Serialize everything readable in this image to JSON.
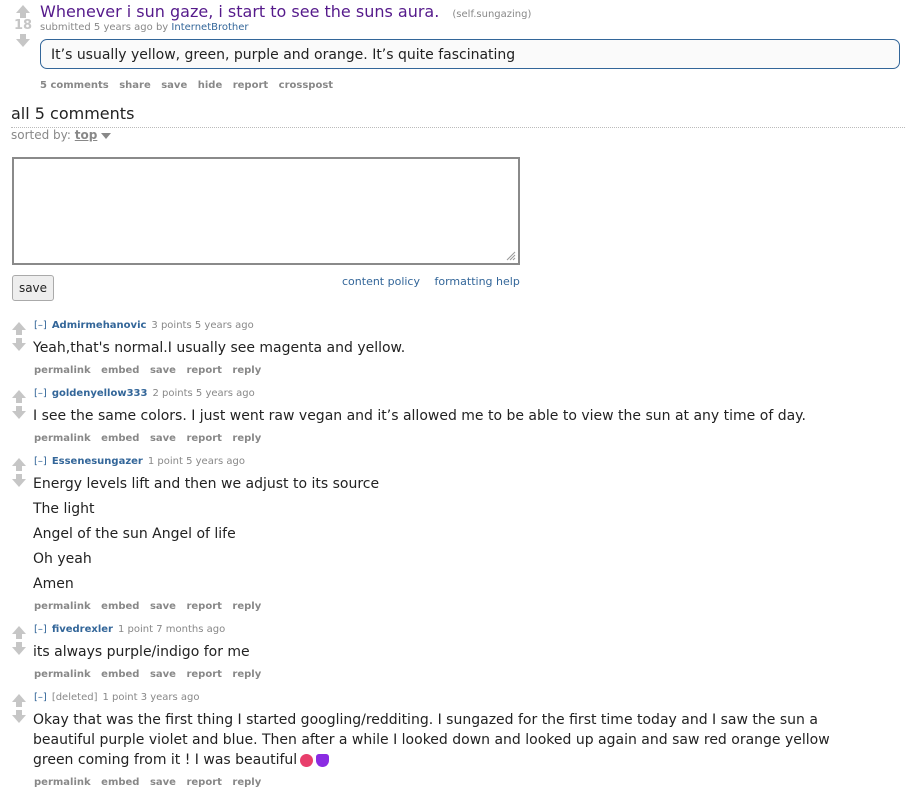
{
  "post": {
    "score": "18",
    "title": "Whenever i sun gaze, i start to see the suns aura.",
    "domain": "(self.sungazing)",
    "submitted_prefix": "submitted 5 years ago by",
    "author": "InternetBrother",
    "selftext": "It’s usually yellow, green, purple and orange. It’s quite fascinating",
    "buttons": [
      "5 comments",
      "share",
      "save",
      "hide",
      "report",
      "crosspost"
    ]
  },
  "comments_header": "all 5 comments",
  "sort": {
    "label": "sorted by:",
    "value": "top"
  },
  "reply_form": {
    "save_label": "save",
    "content_policy": "content policy",
    "formatting_help": "formatting help"
  },
  "comment_buttons": [
    "permalink",
    "embed",
    "save",
    "report",
    "reply"
  ],
  "comments": [
    {
      "expand": "[–]",
      "author": "Admirmehanovic",
      "meta": "3 points 5 years ago",
      "lines": [
        "Yeah,that's normal.I usually see magenta and yellow."
      ]
    },
    {
      "expand": "[–]",
      "author": "goldenyellow333",
      "meta": "2 points 5 years ago",
      "lines": [
        "I see the same colors. I just went raw vegan and it’s allowed me to be able to view the sun at any time of day."
      ]
    },
    {
      "expand": "[–]",
      "author": "Essenesungazer",
      "meta": "1 point 5 years ago",
      "lines": [
        "Energy levels lift and then we adjust to its source",
        "The light",
        "Angel of the sun Angel of life",
        "Oh yeah",
        "Amen"
      ]
    },
    {
      "expand": "[–]",
      "author": "fivedrexler",
      "meta": "1 point 7 months ago",
      "lines": [
        "its always purple/indigo for me"
      ]
    },
    {
      "expand": "[–]",
      "author": "[deleted]",
      "meta": "1 point 3 years ago",
      "lines": [
        "Okay that was the first thing I started googling/redditing. I sungazed for the first time today and I saw the sun a beautiful purple violet and blue. Then after a while I looked down and looked up again and saw red orange yellow green coming from it ! I was beautiful"
      ]
    }
  ],
  "icons": [
    "upvote-arrow-icon",
    "downvote-arrow-icon",
    "heart-eyes-emoji-icon",
    "purple-heart-emoji-icon",
    "sort-dropdown-icon",
    "resize-grip-icon"
  ]
}
